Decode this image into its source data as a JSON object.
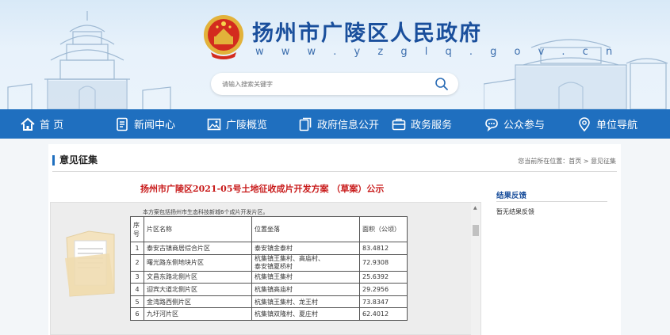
{
  "site": {
    "title": "扬州市广陵区人民政府",
    "url": "w w w . y z g l q . g o v . c n",
    "search_placeholder": "请输入搜索关键字"
  },
  "nav": {
    "items": [
      {
        "label": "首  页",
        "icon": "home-icon"
      },
      {
        "label": "新闻中心",
        "icon": "document-icon"
      },
      {
        "label": "广陵概览",
        "icon": "image-icon"
      },
      {
        "label": "政府信息公开",
        "icon": "file-icon"
      },
      {
        "label": "政务服务",
        "icon": "briefcase-icon"
      },
      {
        "label": "公众参与",
        "icon": "chat-icon"
      },
      {
        "label": "单位导航",
        "icon": "location-pin-icon"
      }
    ]
  },
  "section": {
    "title": "意见征集",
    "breadcrumb": "您当前所在位置：首页 > 意见征集"
  },
  "document": {
    "title": "扬州市广陵区2021-05号土地征收成片开发方案 （草案）公示",
    "intro": "本方案包括扬州市生态科技新城6个成片开发片区。",
    "table": {
      "headers": {
        "no": "序号",
        "name": "片区名称",
        "location": "位置坐落",
        "area": "面积（公顷）"
      },
      "rows": [
        {
          "no": "1",
          "name": "泰安古镇商居综合片区",
          "location": "泰安镇金泰村",
          "area": "83.4812"
        },
        {
          "no": "2",
          "name": "曙光路东侧地块片区",
          "location_line1": "杭集镇王集村、高庙村、",
          "location_line2": "泰安镇夏桥村",
          "area": "72.9308"
        },
        {
          "no": "3",
          "name": "文昌东路北侧片区",
          "location": "杭集镇王集村",
          "area": "25.6392"
        },
        {
          "no": "4",
          "name": "迎宾大道北侧片区",
          "location": "杭集镇高庙村",
          "area": "29.2956"
        },
        {
          "no": "5",
          "name": "金湾路西侧片区",
          "location": "杭集镇王集村、龙王村",
          "area": "73.8347"
        },
        {
          "no": "6",
          "name": "九圩河片区",
          "location": "杭集镇双隆村、夏庄村",
          "area": "62.4012"
        }
      ]
    }
  },
  "sidebar": {
    "title": "结果反馈",
    "link": "暂无结果反馈"
  },
  "colors": {
    "primary": "#1f6fbf",
    "title_red": "#c81a1a",
    "site_title": "#1a4f9c"
  }
}
